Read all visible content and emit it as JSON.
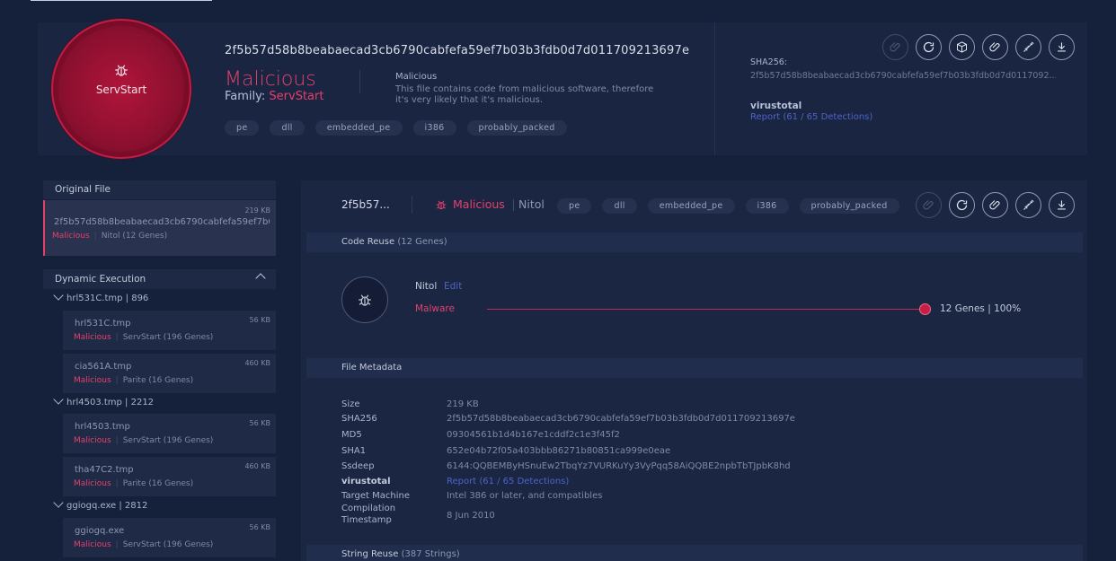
{
  "header": {
    "family_name": "ServStart",
    "hash": "2f5b57d58b8beabaecad3cb6790cabfefa59ef7b03b3fdb0d7d011709213697e",
    "verdict": "Malicious",
    "family_label": "Family:",
    "family_value": "ServStart",
    "verdict_desc_title": "Malicious",
    "verdict_desc": "This file contains code from malicious software, therefore it's very likely that it's malicious.",
    "tags": [
      "pe",
      "dll",
      "embedded_pe",
      "i386",
      "probably_packed"
    ],
    "sha256_label": "SHA256:",
    "sha256_value": "2f5b57d58b8beabaecad3cb6790cabfefa59ef7b03b3fdb0d7d0117092...",
    "virustotal_label": "virustotal",
    "virustotal_link": "Report (61 / 65 Detections)"
  },
  "sidebar": {
    "original_header": "Original File",
    "original_item": {
      "size": "219 KB",
      "name": "2f5b57d58b8beabaecad3cb6790cabfefa59ef7b0...",
      "verdict": "Malicious",
      "family": "Nitol (12 Genes)"
    },
    "dynamic_header": "Dynamic Execution",
    "processes": [
      {
        "label": "hrl531C.tmp | 896"
      },
      {
        "label": "hrl4503.tmp | 2212"
      },
      {
        "label": "ggiogq.exe | 2812"
      }
    ],
    "children": [
      {
        "name": "hrl531C.tmp",
        "size": "56 KB",
        "verdict": "Malicious",
        "family": "ServStart (196 Genes)"
      },
      {
        "name": "cia561A.tmp",
        "size": "460 KB",
        "verdict": "Malicious",
        "family": "Parite (16 Genes)"
      },
      {
        "name": "hrl4503.tmp",
        "size": "56 KB",
        "verdict": "Malicious",
        "family": "ServStart (196 Genes)"
      },
      {
        "name": "tha47C2.tmp",
        "size": "460 KB",
        "verdict": "Malicious",
        "family": "Parite (16 Genes)"
      },
      {
        "name": "ggiogq.exe",
        "size": "56 KB",
        "verdict": "Malicious",
        "family": "ServStart (196 Genes)"
      }
    ]
  },
  "main": {
    "title": "2f5b57...",
    "verdict": "Malicious",
    "family": "Nitol",
    "tags": [
      "pe",
      "dll",
      "embedded_pe",
      "i386",
      "probably_packed"
    ],
    "code_reuse": {
      "header": "Code Reuse",
      "count": "(12 Genes)",
      "gene_name": "Nitol",
      "edit": "Edit",
      "type": "Malware",
      "result": "12 Genes | 100%",
      "percent": 100
    },
    "metadata_header": "File Metadata",
    "metadata": [
      {
        "key": "Size",
        "value": "219 KB"
      },
      {
        "key": "SHA256",
        "value": "2f5b57d58b8beabaecad3cb6790cabfefa59ef7b03b3fdb0d7d011709213697e"
      },
      {
        "key": "MD5",
        "value": "09304561b1d4b167e1cddf2c1e3f45f2"
      },
      {
        "key": "SHA1",
        "value": "652e04b72f05a403bbb86271b80851ca999e0eae"
      },
      {
        "key": "Ssdeep",
        "value": "6144:QQBEMByHSnuEw2TbqYz7VURKuYy3VyPqq58AiQQBE2npbTbTJpbK8hd"
      },
      {
        "key": "virustotal",
        "value": "Report (61 / 65 Detections)"
      },
      {
        "key": "Target Machine",
        "value": "Intel 386 or later, and compatibles"
      },
      {
        "key": "Compilation",
        "value": "8 Jun 2010"
      },
      {
        "key": "Timestamp",
        "value": ""
      }
    ],
    "string_reuse_header": "String Reuse",
    "string_reuse_count": "(387 Strings)"
  },
  "colors": {
    "accent": "#e5406a",
    "link": "#4d64c7",
    "bg": "#15203a"
  }
}
